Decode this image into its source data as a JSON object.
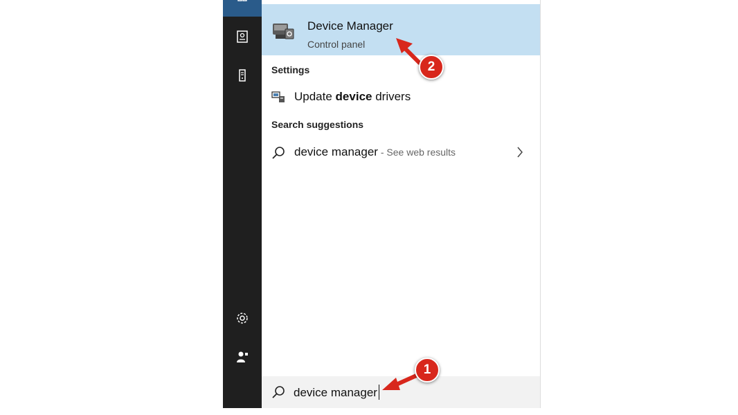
{
  "best_match": {
    "title": "Device Manager",
    "subtitle": "Control panel"
  },
  "settings": {
    "heading": "Settings",
    "items": [
      {
        "label_prefix": "Update ",
        "label_bold": "device",
        "label_suffix": " drivers"
      }
    ]
  },
  "suggestions": {
    "heading": "Search suggestions",
    "items": [
      {
        "label": "device manager",
        "hint": " - See web results"
      }
    ]
  },
  "search": {
    "value": "device manager"
  },
  "annotations": {
    "step1": "1",
    "step2": "2"
  },
  "colors": {
    "accent_highlight": "#c3dff2",
    "rail": "#1f1f1f",
    "annotation": "#d8271c"
  },
  "icons": {
    "rail": [
      "tiles-icon",
      "document-icon",
      "tower-icon",
      "gear-icon",
      "user-icon"
    ],
    "best_match": "device-manager-icon",
    "settings_item": "device-drivers-icon",
    "suggestion": "search-icon"
  }
}
